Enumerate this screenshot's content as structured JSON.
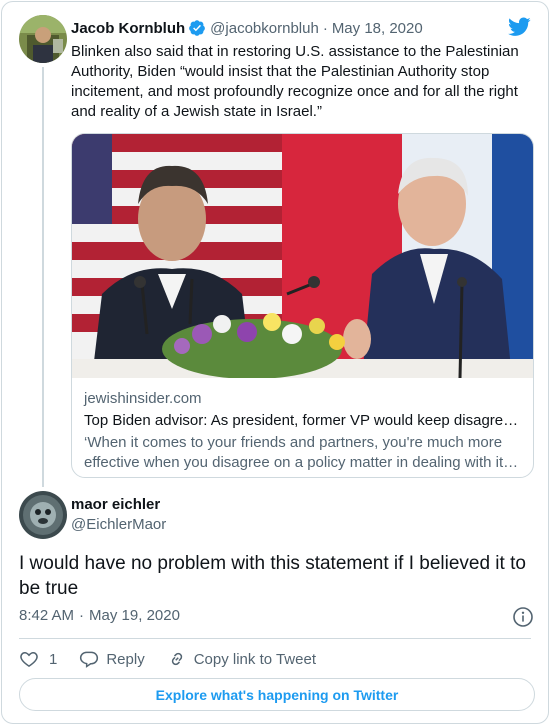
{
  "parent_tweet": {
    "author_name": "Jacob Kornbluh",
    "handle": "@jacobkornbluh",
    "separator": "·",
    "date": "May 18, 2020",
    "text": "Blinken also said that in restoring U.S. assistance to the Palestinian Authority, Biden “would insist that the Palestinian Authority stop incitement, and most profoundly recognize once and for all the right and reality of a Jewish state in Israel.”",
    "verified": true,
    "link_card": {
      "domain": "jewishinsider.com",
      "title": "Top Biden advisor: As president, former VP would keep disagre…",
      "description": "‘When it comes to your friends and partners, you're much more effective when you disagree on a policy matter in dealing with it…"
    }
  },
  "reply_tweet": {
    "author_name": "maor eichler",
    "handle": "@EichlerMaor",
    "text": "I would have no problem with this statement if I believed it to be true",
    "time": "8:42 AM",
    "separator": "·",
    "date": "May 19, 2020"
  },
  "actions": {
    "like_count": "1",
    "reply_label": "Reply",
    "copy_link_label": "Copy link to Tweet"
  },
  "footer": {
    "explore_label": "Explore what's happening on Twitter"
  },
  "colors": {
    "accent": "#1d9bf0",
    "text": "#0f1419",
    "secondary": "#536471",
    "border": "#cfd9de"
  },
  "icons": [
    "twitter-bird-icon",
    "verified-badge-icon",
    "info-icon",
    "heart-icon",
    "reply-icon",
    "link-icon"
  ]
}
